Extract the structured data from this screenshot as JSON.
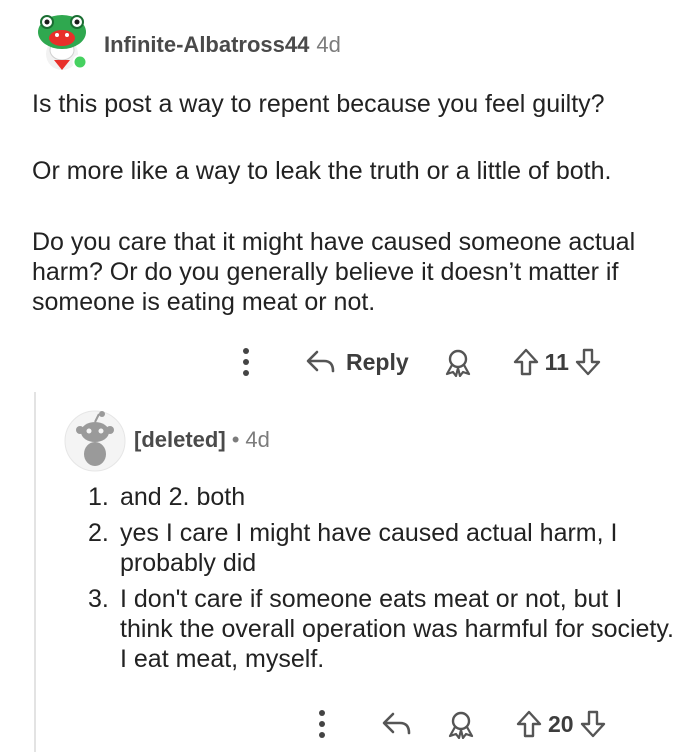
{
  "comment": {
    "author": "Infinite-Albatross44",
    "age": "4d",
    "paragraphs": [
      "Is this post a way to repent because you feel guilty?",
      "Or more like a way to leak the truth or a little of both.",
      "Do you care that it might have caused someone actual harm? Or do you generally believe it doesn’t matter if someone is eating meat or not."
    ],
    "actions": {
      "more_icon": "more-vertical-icon",
      "reply_icon": "reply-arrow-icon",
      "reply_label": "Reply",
      "award_icon": "award-icon",
      "upvote_icon": "upvote-icon",
      "vote_count": "11",
      "downvote_icon": "downvote-icon"
    }
  },
  "reply": {
    "author": "[deleted]",
    "separator": "•",
    "age": "4d",
    "items": [
      {
        "num": "1.",
        "text": "and 2. both"
      },
      {
        "num": "2.",
        "text": "yes I care I might have caused actual harm, I probably did"
      },
      {
        "num": "3.",
        "text": "I don't care if someone eats meat or not, but I think the overall operation was harmful for society. I eat meat, myself."
      }
    ],
    "actions": {
      "more_icon": "more-vertical-icon",
      "reply_icon": "reply-arrow-icon",
      "award_icon": "award-icon",
      "upvote_icon": "upvote-icon",
      "vote_count": "20",
      "downvote_icon": "downvote-icon"
    }
  },
  "colors": {
    "online_status": "#46d160",
    "avatar_green": "#2fa84f",
    "avatar_red": "#e8302a"
  }
}
